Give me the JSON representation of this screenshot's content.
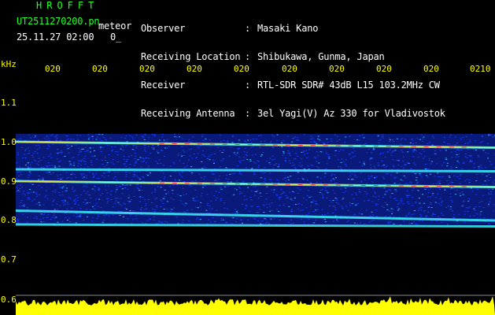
{
  "header": {
    "title": "HROFFT",
    "filename": "UT2511270200.pn",
    "meteor_label": "meteor",
    "datetime": "25.11.27 02:00",
    "flag": "0_"
  },
  "station": {
    "labels": [
      "Observer",
      "Receiving Location",
      "Receiver",
      "Receiving Antenna"
    ],
    "colons": [
      ":",
      ":",
      ":",
      ":"
    ],
    "values": [
      "Masaki Kano",
      "Shibukawa, Gunma, Japan",
      "RTL-SDR SDR# 43dB L15 103.2MHz CW",
      "3el Yagi(V) Az 330 for Vladivostok"
    ]
  },
  "axes": {
    "y_unit": "kHz",
    "y_ticks": [
      "1.1",
      "1.0",
      "0.9",
      "0.8",
      "0.7",
      "0.6"
    ],
    "x_ticks": [
      "020",
      "020",
      "020",
      "020",
      "020",
      "020",
      "020",
      "020",
      "020",
      "0210"
    ]
  },
  "colors": {
    "header_green": "#22ff22",
    "header_white": "#ffffff",
    "axis_yellow": "#ffff00",
    "band_blue": "#1a3cff",
    "signal_cyan": "#3ff0ff",
    "signal_red": "#ff2020",
    "noise_floor": "#ffff00"
  },
  "chart_data": {
    "type": "heatmap",
    "ylabel": "kHz",
    "ylim": [
      0.6,
      1.15
    ],
    "band_range_khz": [
      0.79,
      1.02
    ],
    "carriers": [
      {
        "name": "",
        "start_khz": 1.0,
        "end_khz": 0.985
      },
      {
        "name": "",
        "start_khz": 0.9,
        "end_khz": 0.885
      },
      {
        "name": "",
        "start_khz": 0.825,
        "end_khz": 0.8
      },
      {
        "name": "",
        "start_khz": 0.93,
        "end_khz": 0.925
      },
      {
        "name": "",
        "start_khz": 0.79,
        "end_khz": 0.785
      }
    ]
  }
}
